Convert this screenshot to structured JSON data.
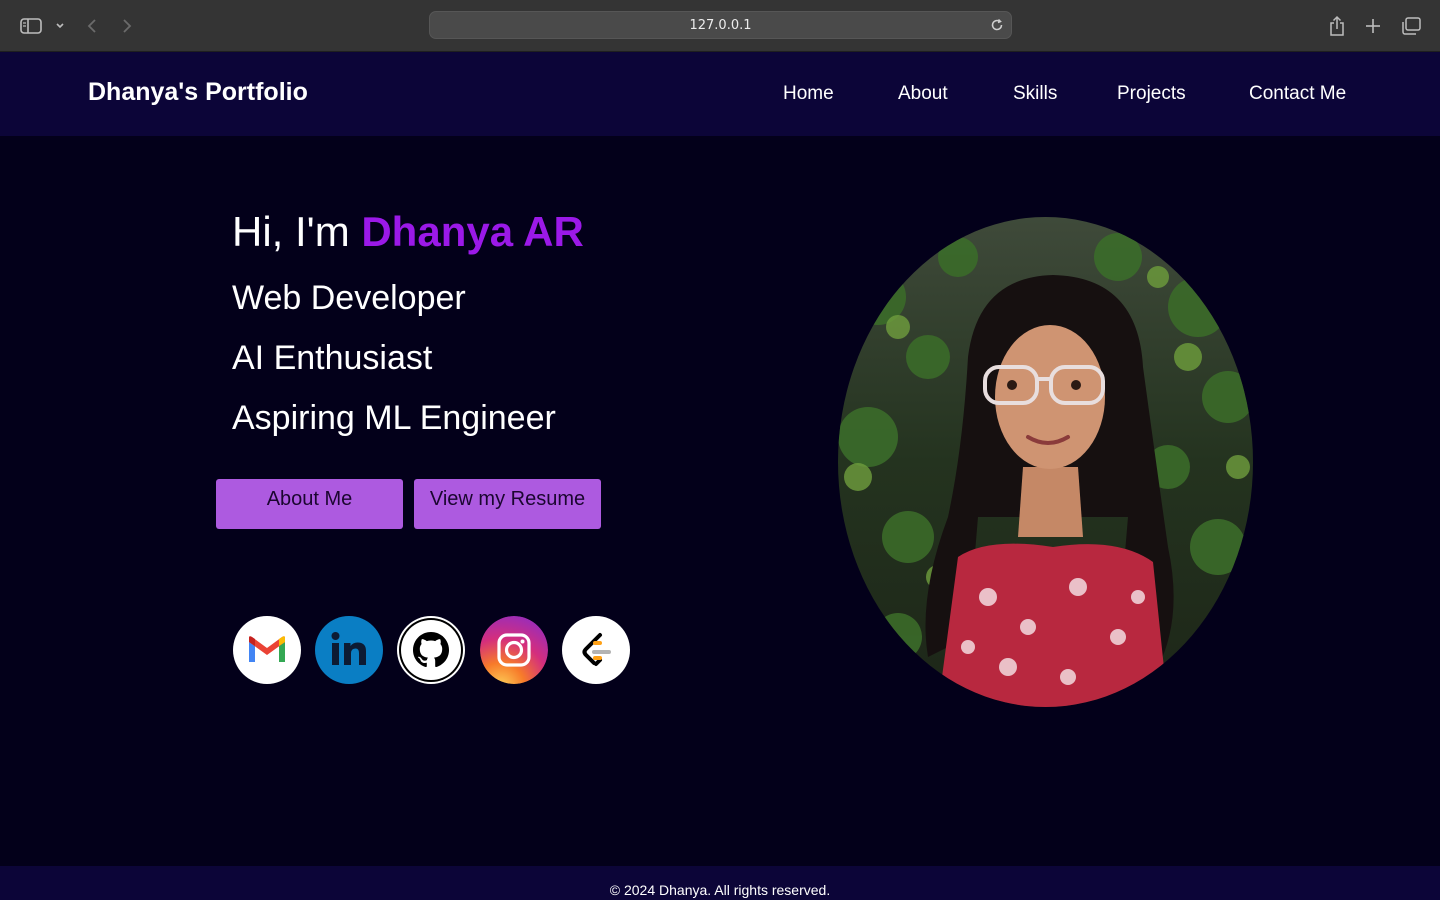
{
  "browser": {
    "url": "127.0.0.1",
    "icons": [
      "sidebar-icon",
      "chevron-down-icon",
      "back-icon",
      "forward-icon",
      "reload-icon",
      "share-icon",
      "plus-icon",
      "tabs-icon"
    ]
  },
  "nav": {
    "brand": "Dhanya's Portfolio",
    "links": [
      "Home",
      "About",
      "Skills",
      "Projects",
      "Contact Me"
    ]
  },
  "hero": {
    "greeting": "Hi, I'm ",
    "name": "Dhanya AR",
    "roles": [
      "Web Developer",
      "AI Enthusiast",
      "Aspiring ML Engineer"
    ],
    "buttons": [
      "About Me",
      "View my Resume"
    ],
    "socials": [
      "gmail-icon",
      "linkedin-icon",
      "github-icon",
      "instagram-icon",
      "leetcode-icon"
    ]
  },
  "colors": {
    "background": "#03001a",
    "nav": "#0c0538",
    "accent": "#9b19e8",
    "button": "#ad5ae0"
  },
  "footer": {
    "text": "© 2024 Dhanya. All rights reserved."
  }
}
